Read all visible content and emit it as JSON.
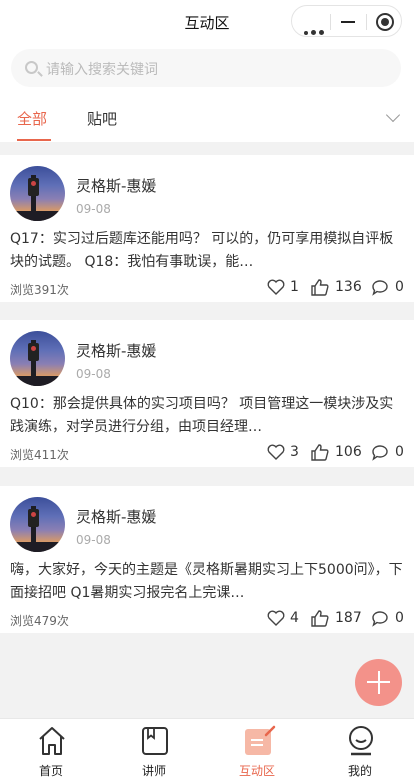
{
  "titlebar": {
    "title": "互动区"
  },
  "search": {
    "placeholder": "请输入搜索关键词"
  },
  "tabs": [
    {
      "label": "全部",
      "active": true
    },
    {
      "label": "贴吧",
      "active": false
    }
  ],
  "posts": [
    {
      "author": "灵格斯-惠媛",
      "date": "09-08",
      "content": "Q17：实习过后题库还能用吗？ 可以的，仍可享用模拟自评板块的试题。 Q18：我怕有事耽误，能…",
      "views": "浏览391次",
      "likes": "1",
      "thumbs": "136",
      "comments": "0"
    },
    {
      "author": "灵格斯-惠媛",
      "date": "09-08",
      "content": "Q10：那会提供具体的实习项目吗？ 项目管理这一模块涉及实践演练，对学员进行分组，由项目经理…",
      "views": "浏览411次",
      "likes": "3",
      "thumbs": "106",
      "comments": "0"
    },
    {
      "author": "灵格斯-惠媛",
      "date": "09-08",
      "content": "嗨，大家好，今天的主题是《灵格斯暑期实习上下5000问》，下面接招吧 Q1暑期实习报完名上完课…",
      "views": "浏览479次",
      "likes": "4",
      "thumbs": "187",
      "comments": "0"
    }
  ],
  "bottom_nav": [
    {
      "label": "首页",
      "icon": "home-icon"
    },
    {
      "label": "讲师",
      "icon": "lecturer-book-icon"
    },
    {
      "label": "互动区",
      "icon": "interaction-icon",
      "active": true
    },
    {
      "label": "我的",
      "icon": "profile-icon"
    }
  ],
  "colors": {
    "accent": "#e8664c",
    "fab": "#f3928a",
    "background": "#f2f2f2"
  }
}
